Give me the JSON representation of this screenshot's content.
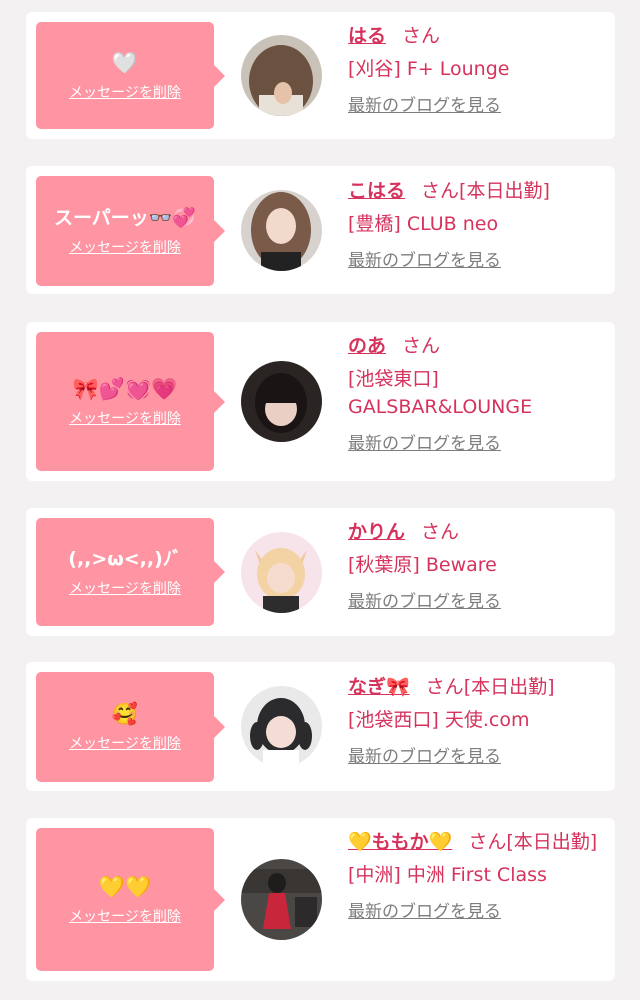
{
  "list": {
    "delete_label": "メッセージを削除",
    "blog_label": "最新のブログを見る",
    "san_label": "さん",
    "items": [
      {
        "message": "🤍",
        "name": "はる",
        "status": "",
        "shop": "[刈谷] F+ Lounge",
        "avatar": "brown-bob-hair"
      },
      {
        "message": "スーパーッ👓💞",
        "name": "こはる",
        "status": "[本日出勤]",
        "shop": "[豊橋] CLUB neo",
        "avatar": "long-hair-selfie"
      },
      {
        "message": "🎀💕💓💗",
        "name": "のあ",
        "status": "",
        "shop": "[池袋東口] GALSBAR&LOUNGE",
        "avatar": "dark-bangs-portrait"
      },
      {
        "message": "(,,>ω<,,)ﾉﾞ",
        "name": "かりん",
        "status": "",
        "shop": "[秋葉原] Beware",
        "avatar": "blonde-cat-ears"
      },
      {
        "message": "🥰",
        "name": "なぎ🎀",
        "status": "[本日出勤]",
        "shop": "[池袋西口] 天使.com",
        "avatar": "twin-tails-portrait"
      },
      {
        "message": "💛💛",
        "name": "💛ももか💛",
        "status": "[本日出勤]",
        "shop": "[中洲] 中洲 First Class",
        "avatar": "red-dress-room"
      }
    ]
  }
}
